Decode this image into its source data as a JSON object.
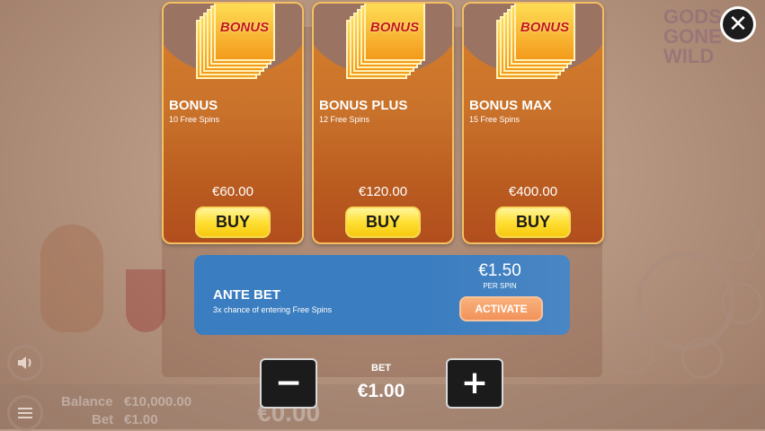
{
  "background": {
    "logo_lines": [
      "GODS",
      "GONE",
      "WILD"
    ],
    "balance_label": "Balance",
    "balance_value": "€10,000.00",
    "bet_label": "Bet",
    "bet_value": "€1.00",
    "win_value": "€0.00"
  },
  "bonus_cards": [
    {
      "ticket_label": "BONUS",
      "title": "BONUS",
      "subtitle": "10 Free Spins",
      "price": "€60.00",
      "buy_label": "BUY"
    },
    {
      "ticket_label": "BONUS",
      "title": "BONUS PLUS",
      "subtitle": "12 Free Spins",
      "price": "€120.00",
      "buy_label": "BUY"
    },
    {
      "ticket_label": "BONUS",
      "title": "BONUS MAX",
      "subtitle": "15 Free Spins",
      "price": "€400.00",
      "buy_label": "BUY"
    }
  ],
  "ante_bet": {
    "title": "ANTE BET",
    "description": "3x chance of entering Free Spins",
    "amount": "€1.50",
    "per_spin": "PER SPIN",
    "activate_label": "ACTIVATE"
  },
  "bet_control": {
    "label": "BET",
    "value": "€1.00",
    "decrease_glyph": "−",
    "increase_glyph": "+"
  },
  "close_glyph": "✕",
  "icons": {
    "close": "close-icon",
    "decrease": "minus-icon",
    "increase": "plus-icon",
    "volume": "speaker-icon",
    "menu": "menu-icon"
  },
  "colors": {
    "card_gradient_top": "#d77f2c",
    "card_border": "#f4c061",
    "buy_button": "#ffe034",
    "ante_panel": "#3a7dc0",
    "activate_button": "#f2925a"
  }
}
